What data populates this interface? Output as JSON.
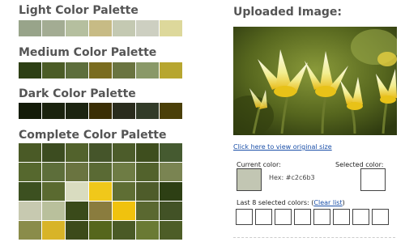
{
  "sections": {
    "light": {
      "title": "Light Color Palette",
      "colors": [
        "#98a48a",
        "#a3ac93",
        "#b5bf9f",
        "#c7bb85",
        "#c4c9b2",
        "#cdcfc1",
        "#ddd89b"
      ]
    },
    "medium": {
      "title": "Medium Color Palette",
      "colors": [
        "#2d3f14",
        "#4b5c26",
        "#5d6e3c",
        "#7a6c1f",
        "#6a7440",
        "#8a9968",
        "#b7a630"
      ]
    },
    "dark": {
      "title": "Dark Color Palette",
      "colors": [
        "#141b08",
        "#1a220e",
        "#1c2411",
        "#3a2e05",
        "#2a2c1d",
        "#323b28",
        "#4a3f08"
      ]
    },
    "complete": {
      "title": "Complete Color Palette",
      "colors": [
        "#4a5a26",
        "#3c4c20",
        "#52622c",
        "#45552a",
        "#4c5c2a",
        "#3e4e1e",
        "#455a30",
        "#56682e",
        "#5d6e3a",
        "#6a7440",
        "#5a6a34",
        "#6e7c44",
        "#52622c",
        "#7a8452",
        "#3c5020",
        "#5a6a30",
        "#d9dcc0",
        "#f0c81a",
        "#5f6e34",
        "#4e5c2a",
        "#2d3f14",
        "#c7c9b0",
        "#b9c09c",
        "#3a4a1a",
        "#8a7c3e",
        "#f0c20e",
        "#5a6830",
        "#425226",
        "#8a8c4a",
        "#d8b428",
        "#3c4a1a",
        "#55661c",
        "#4a5a26",
        "#6a7a34",
        "#4d5d27"
      ]
    }
  },
  "uploaded": {
    "title": "Uploaded Image:",
    "link_text": "Click here to view original size"
  },
  "current_color": {
    "label": "Current color:",
    "hex_text": "Hex: #c2c6b3",
    "value": "#c2c6b3"
  },
  "selected_color": {
    "label": "Selected color:"
  },
  "last_selected": {
    "label": "Last 8 selected colors:",
    "open_paren": "(",
    "clear_link": "Clear list",
    "close_paren": ")"
  },
  "icons": {
    "uploaded_image": "tulip-photo"
  }
}
